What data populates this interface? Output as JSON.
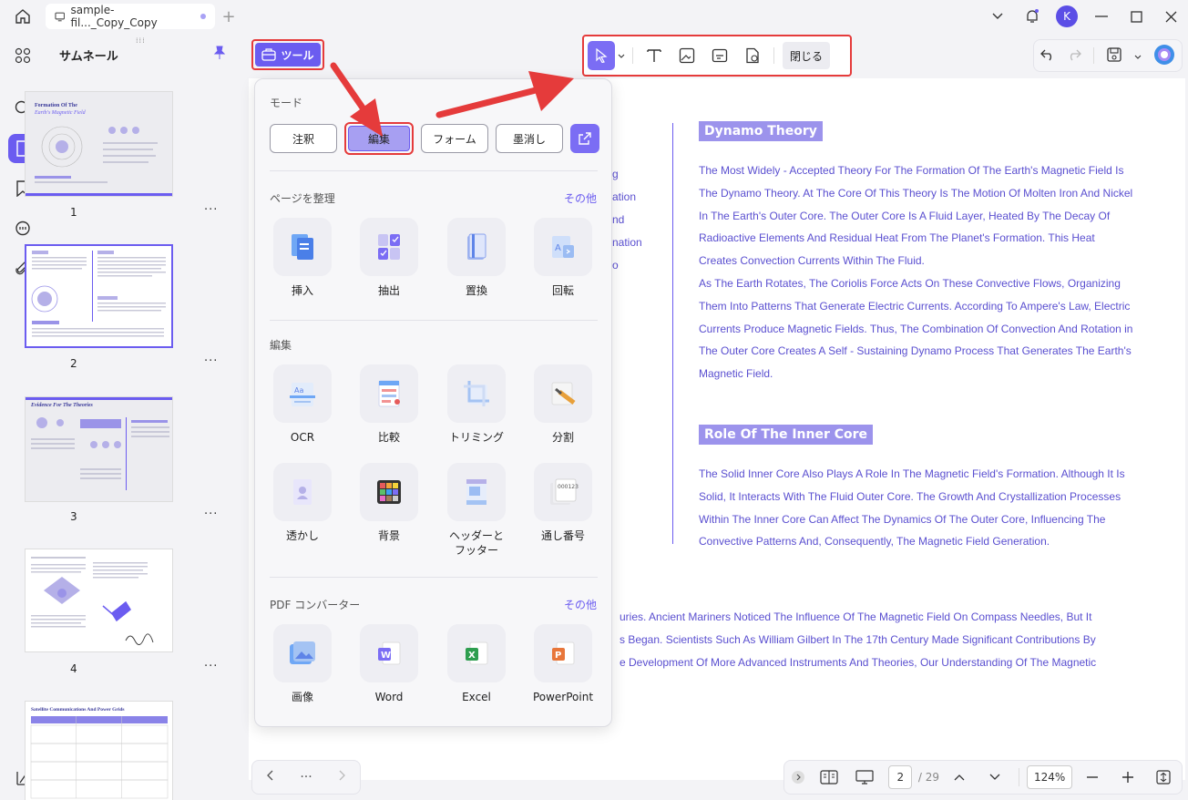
{
  "titlebar": {
    "tab_title": "sample-fil..._Copy_Copy"
  },
  "thumbnails": {
    "title": "サムネール",
    "pages": [
      {
        "num": "1",
        "heading_1": "Formation Of The",
        "heading_2": "Earth's Magnetic Field"
      },
      {
        "num": "2"
      },
      {
        "num": "3",
        "heading": "Evidence For The Theories"
      },
      {
        "num": "4"
      },
      {
        "num": "",
        "heading": "Satellite Communications And Power Grids"
      }
    ],
    "more": "···"
  },
  "toolbar": {
    "tool_label": "ツール",
    "close_label": "閉じる"
  },
  "popup": {
    "mode_title": "モード",
    "modes": [
      "注釈",
      "編集",
      "フォーム",
      "墨消し"
    ],
    "organize_title": "ページを整理",
    "organize_more": "その他",
    "organize_items": [
      "挿入",
      "抽出",
      "置換",
      "回転"
    ],
    "edit_title": "編集",
    "edit_items": [
      "OCR",
      "比較",
      "トリミング",
      "分割",
      "透かし",
      "背景",
      "ヘッダーと\nフッター",
      "通し番号"
    ],
    "converter_title": "PDF コンバーター",
    "converter_more": "その他",
    "converter_items": [
      "画像",
      "Word",
      "Excel",
      "PowerPoint"
    ]
  },
  "document": {
    "heading_1": "Dynamo Theory",
    "para_1": "The Most Widely - Accepted Theory For The Formation Of The Earth's Magnetic Field Is The Dynamo Theory. At The Core Of This Theory Is The Motion Of Molten Iron And Nickel In The Earth's Outer Core. The Outer Core Is A Fluid Layer, Heated By The Decay Of Radioactive Elements And Residual Heat From The Planet's Formation. This Heat Creates Convection Currents Within The Fluid.",
    "para_2": "As The Earth Rotates, The Coriolis Force Acts On These Convective Flows, Organizing Them Into Patterns That Generate Electric Currents. According To Ampere's Law, Electric Currents Produce Magnetic Fields. Thus, The Combination Of Convection And Rotation in The Outer Core Creates A Self - Sustaining Dynamo Process That Generates The Earth's Magnetic Field.",
    "heading_2": "Role Of The Inner Core",
    "para_3": "The Solid Inner Core Also Plays A Role In The Magnetic Field's Formation. Although It Is Solid, It Interacts With The Fluid Outer Core. The Growth And Crystallization Processes Within The Inner Core Can Affect The Dynamics Of The Outer Core, Influencing The Convective Patterns And, Consequently, The Magnetic Field Generation.",
    "left_fragments": [
      "g",
      "ation",
      "nd",
      "nation",
      "o"
    ],
    "bottom_lines": [
      "uries. Ancient Mariners Noticed The Influence Of The Magnetic Field On Compass Needles, But It",
      "s Began. Scientists Such As William Gilbert In The 17th Century Made Significant Contributions By",
      "e Development Of More Advanced Instruments And Theories, Our Understanding Of The Magnetic"
    ]
  },
  "bottombar": {
    "more": "···",
    "current_page": "2",
    "total_pages": "/ 29",
    "zoom": "124%"
  },
  "colors": {
    "accent": "#6b5cf0",
    "highlight": "#e53b3b",
    "text_purple": "#5a4fd0"
  }
}
